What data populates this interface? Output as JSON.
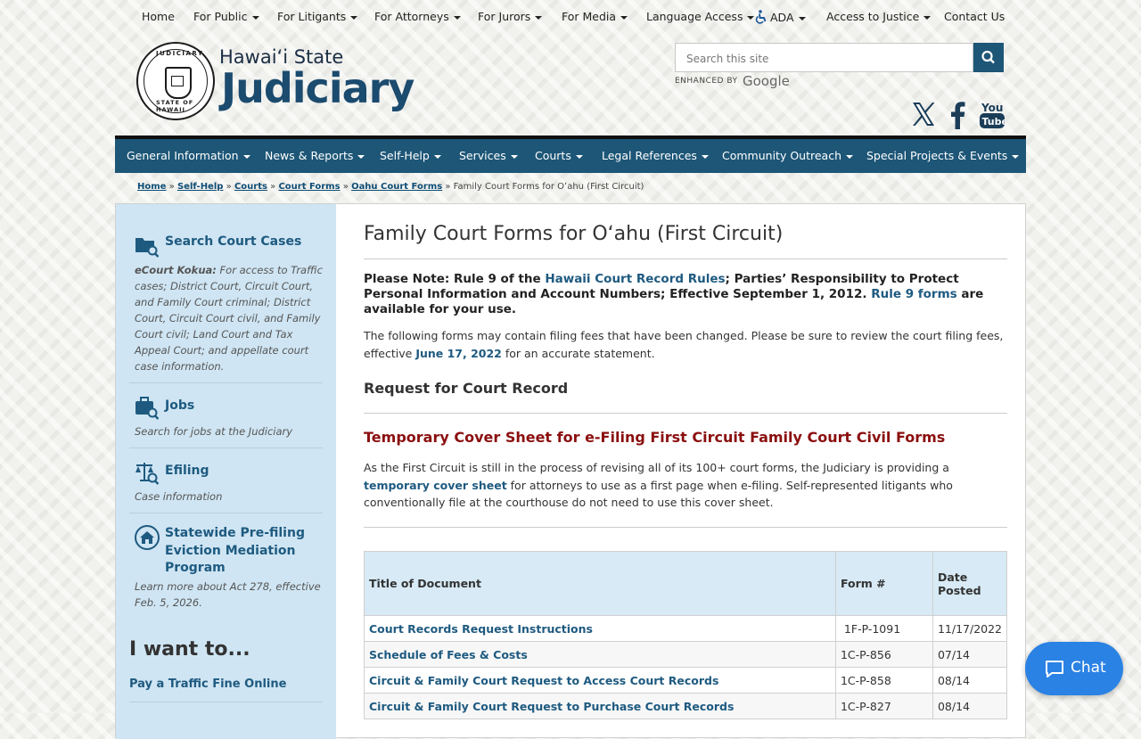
{
  "topnav": [
    {
      "label": "Home",
      "dropdown": false
    },
    {
      "label": "For Public",
      "dropdown": true
    },
    {
      "label": "For Litigants",
      "dropdown": true
    },
    {
      "label": "For Attorneys",
      "dropdown": true
    },
    {
      "label": "For Jurors",
      "dropdown": true
    },
    {
      "label": "For Media",
      "dropdown": true
    },
    {
      "label": "Language Access",
      "dropdown": true
    },
    {
      "label": "ADA",
      "dropdown": true
    },
    {
      "label": "Access to Justice",
      "dropdown": true
    },
    {
      "label": "Contact Us",
      "dropdown": false
    }
  ],
  "brand": {
    "line1": "Hawaiʻi State",
    "line2": "Judiciary",
    "seal_top": "JUDICIARY",
    "seal_bottom": "STATE OF HAWAII"
  },
  "search": {
    "placeholder": "Search this site",
    "enhanced_by": "ENHANCED BY",
    "google": "Google"
  },
  "social": [
    "x-icon",
    "facebook-icon",
    "youtube-icon"
  ],
  "youtube_text": {
    "top": "You",
    "bottom": "Tube"
  },
  "mainnav": [
    "General Information",
    "News & Reports",
    "Self-Help",
    "Services",
    "Courts",
    "Legal References",
    "Community Outreach",
    "Special Projects & Events"
  ],
  "breadcrumb": {
    "links": [
      "Home",
      "Self-Help",
      "Courts",
      "Court Forms",
      "Oahu Court Forms"
    ],
    "current": "Family Court Forms for Oʻahu (First Circuit)",
    "sep": "»"
  },
  "sidebar": {
    "search_cases": {
      "title": "Search Court Cases",
      "desc_bold": "eCourt Kokua:",
      "desc": " For access to Traffic cases; District Court, Circuit Court, and Family Court criminal; District Court, Circuit Court civil, and Family Court civil; Land Court and Tax Appeal Court; and appellate court case information."
    },
    "jobs": {
      "title": "Jobs",
      "desc": "Search for jobs at the Judiciary"
    },
    "efiling": {
      "title": "Efiling",
      "desc": "Case information"
    },
    "eviction": {
      "title": "Statewide Pre-filing Eviction Mediation Program",
      "desc": "Learn more about Act 278, effective Feb. 5, 2026."
    },
    "i_want_to": "I want to...",
    "pay_fine": "Pay a Traffic Fine Online"
  },
  "main": {
    "title": "Family Court Forms for Oʻahu (First Circuit)",
    "note": {
      "pre": "Please Note: Rule 9 of the ",
      "link1": "Hawaii Court Record Rules",
      "mid": "; Parties’ Responsibility to Protect Personal Information and Account Numbers; Effective September 1, 2012. ",
      "link2": "Rule 9 forms",
      "post": " are available for your use."
    },
    "fees": {
      "pre": "The following forms may contain filing fees that have been changed. Please be sure to review the court filing fees, effective ",
      "link": "June 17, 2022",
      "post": " for an accurate statement."
    },
    "request_heading": "Request for Court Record",
    "temp_heading": "Temporary Cover Sheet for e-Filing First Circuit Family Court Civil Forms",
    "temp_para": {
      "pre": "As the First Circuit is still in the process of revising all of its 100+ court forms, the Judiciary is providing a ",
      "link": "temporary cover sheet",
      "post": " for attorneys to use as a first page when e-filing. Self-represented litigants who conventionally file at the courthouse do not need to use this cover sheet."
    },
    "table": {
      "headers": [
        "Title of Document",
        "Form #",
        "Date Posted"
      ],
      "rows": [
        [
          "Court Records Request Instructions",
          " 1F-P-1091",
          "11/17/2022"
        ],
        [
          "Schedule of Fees & Costs",
          "1C-P-856",
          "07/14"
        ],
        [
          "Circuit & Family Court Request to Access Court Records",
          "1C-P-858",
          "08/14"
        ],
        [
          "Circuit & Family Court Request to Purchase Court Records",
          "1C-P-827",
          "08/14"
        ]
      ]
    }
  },
  "chat": {
    "label": "Chat"
  },
  "colors": {
    "nav_bg": "#1d5677",
    "sidebar_bg": "#cfe5f3",
    "link": "#1e5a80",
    "red_heading": "#8b0f0f",
    "chat_bg": "#2a82e4"
  }
}
